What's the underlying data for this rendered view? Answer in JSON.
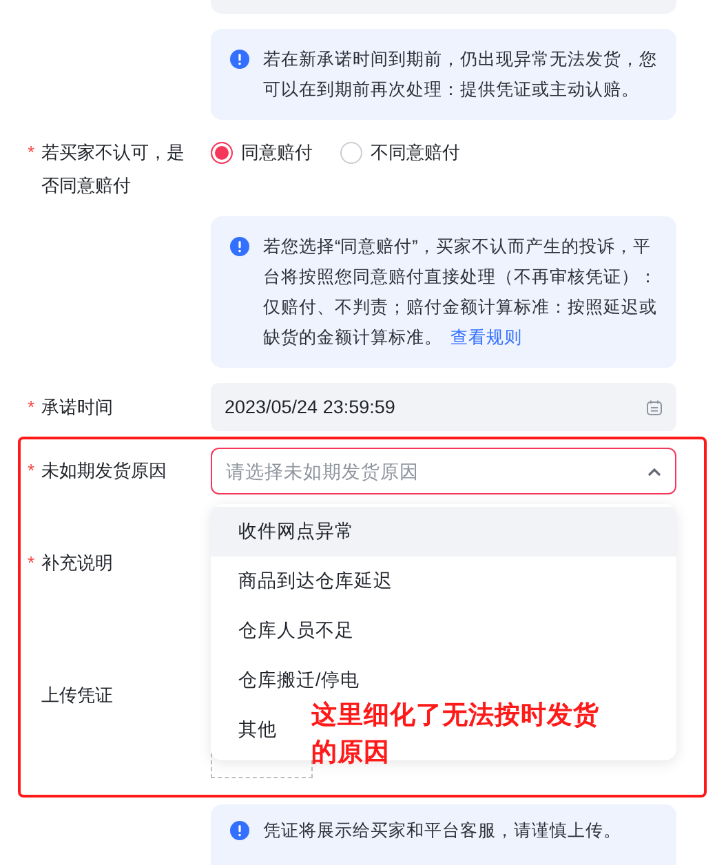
{
  "notice_1": {
    "text": "若在新承诺时间到期前，仍出现异常无法发货，您可以在到期前再次处理：提供凭证或主动认赔。"
  },
  "compensation": {
    "label": "若买家不认可，是否同意赔付",
    "required_mark": "*",
    "options": [
      {
        "label": "同意赔付",
        "selected": true
      },
      {
        "label": "不同意赔付",
        "selected": false
      }
    ]
  },
  "notice_2": {
    "text": "若您选择“同意赔付”，买家不认而产生的投诉，平台将按照您同意赔付直接处理（不再审核凭证）：仅赔付、不判责；赔付金额计算标准：按照延迟或缺货的金额计算标准。",
    "link": "查看规则"
  },
  "promise_time": {
    "label": "承诺时间",
    "required_mark": "*",
    "value": "2023/05/24 23:59:59"
  },
  "delay_reason": {
    "label": "未如期发货原因",
    "required_mark": "*",
    "placeholder": "请选择未如期发货原因",
    "expanded": true,
    "options": [
      {
        "label": "收件网点异常",
        "highlighted": true
      },
      {
        "label": "商品到达仓库延迟",
        "highlighted": false
      },
      {
        "label": "仓库人员不足",
        "highlighted": false
      },
      {
        "label": "仓库搬迁/停电",
        "highlighted": false
      },
      {
        "label": "其他",
        "highlighted": false
      }
    ]
  },
  "note": {
    "label": "补充说明",
    "required_mark": "*"
  },
  "upload": {
    "label": "上传凭证"
  },
  "annotation": {
    "text": "这里细化了无法按时发货的原因"
  },
  "notice_3": {
    "text": "凭证将展示给买家和平台客服，请谨慎上传。"
  }
}
